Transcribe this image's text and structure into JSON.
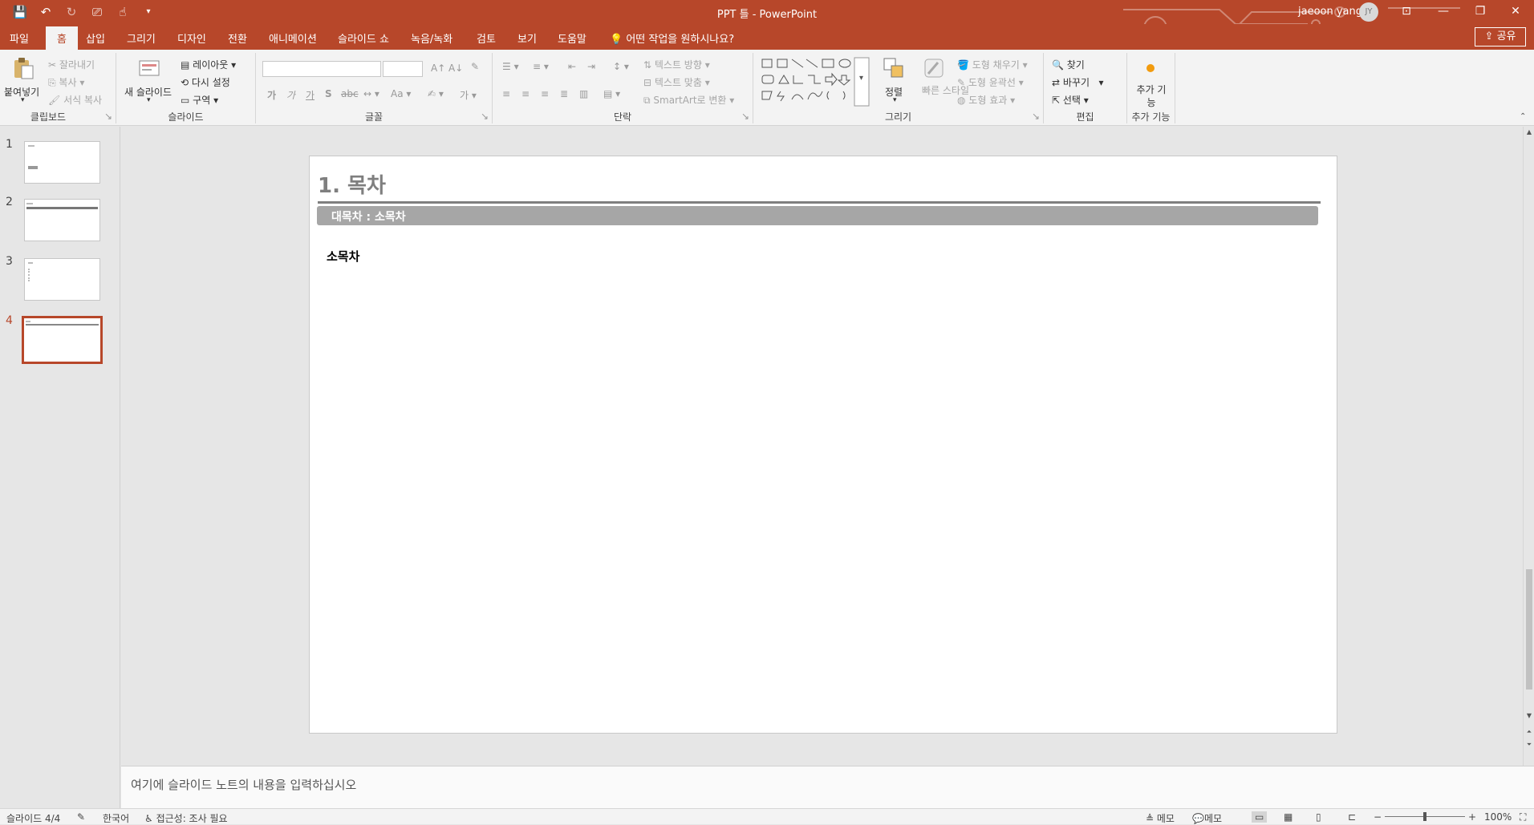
{
  "titlebar": {
    "qat_icons": [
      "save-icon",
      "undo-icon",
      "redo-icon",
      "start-from-beginning-icon",
      "touch-mode-icon",
      "customize-qat-icon"
    ],
    "doc_title": "PPT 틀  -  PowerPoint",
    "user_name": "jaeoon yang",
    "user_initials": "JY"
  },
  "tabs": {
    "items": [
      "파일",
      "홈",
      "삽입",
      "그리기",
      "디자인",
      "전환",
      "애니메이션",
      "슬라이드 쇼",
      "녹음/녹화",
      "검토",
      "보기",
      "도움말"
    ],
    "active": "홈",
    "tell_me": "어떤 작업을 원하시나요?",
    "share": "공유"
  },
  "ribbon": {
    "clipboard": {
      "label": "클립보드",
      "paste": "붙여넣기",
      "cut": "잘라내기",
      "copy": "복사",
      "format_painter": "서식 복사"
    },
    "slides": {
      "label": "슬라이드",
      "new_slide": "새 슬라이드",
      "layout": "레이아웃",
      "reset": "다시 설정",
      "section": "구역"
    },
    "font": {
      "label": "글꼴"
    },
    "paragraph": {
      "label": "단락",
      "text_direction": "텍스트 방향",
      "align_text": "텍스트 맞춤",
      "smartart": "SmartArt로 변환"
    },
    "drawing": {
      "label": "그리기",
      "arrange": "정렬",
      "quick_styles": "빠른 스타일",
      "shape_fill": "도형 채우기",
      "shape_outline": "도형 윤곽선",
      "shape_effects": "도형 효과"
    },
    "editing": {
      "label": "편집",
      "find": "찾기",
      "replace": "바꾸기",
      "select": "선택"
    },
    "addins": {
      "label": "추가 기능",
      "button": "추가 기능"
    }
  },
  "thumbnails": {
    "numbers": [
      "1",
      "2",
      "3",
      "4"
    ],
    "active_index": 4
  },
  "slide": {
    "title": "1. 목차",
    "header_bar": "대목차 : 소목차",
    "subtitle": "소목차"
  },
  "notes": {
    "placeholder": "여기에 슬라이드 노트의 내용을 입력하십시오"
  },
  "statusbar": {
    "slide_count": "슬라이드 4/4",
    "language": "한국어",
    "accessibility": "접근성: 조사 필요",
    "notes_btn": "메모",
    "comments_btn": "메모",
    "zoom": "100%"
  },
  "colors": {
    "accent": "#b7472a",
    "ribbon_bg": "#f3f3f3",
    "slide_title": "#7f7f7f",
    "header_bar": "#a6a6a6"
  }
}
